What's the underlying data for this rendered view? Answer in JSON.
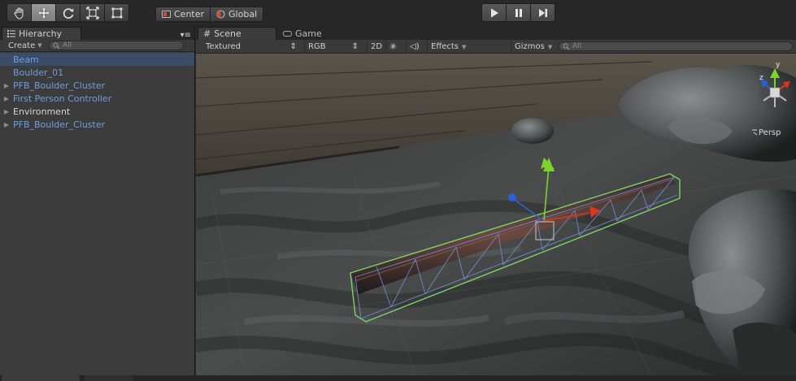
{
  "toolbar": {
    "transform_tools": [
      {
        "name": "hand-tool",
        "icon": "hand-icon"
      },
      {
        "name": "move-tool",
        "icon": "move-icon",
        "active": true
      },
      {
        "name": "rotate-tool",
        "icon": "rotate-icon"
      },
      {
        "name": "scale-tool",
        "icon": "scale-icon"
      },
      {
        "name": "rect-tool",
        "icon": "rect-icon"
      }
    ],
    "pivot_label": "Center",
    "space_label": "Global",
    "playback": [
      "play-icon",
      "pause-icon",
      "step-icon"
    ]
  },
  "hierarchy": {
    "tab_label": "Hierarchy",
    "create_label": "Create",
    "search_placeholder": "All",
    "items": [
      {
        "label": "Beam",
        "expandable": false,
        "selected": true,
        "color": "#6d9de0"
      },
      {
        "label": "Boulder_01",
        "expandable": false,
        "color": "#6d9de0"
      },
      {
        "label": "PFB_Boulder_Cluster",
        "expandable": true,
        "color": "#6d9de0"
      },
      {
        "label": "First Person Controller",
        "expandable": true,
        "color": "#6d9de0"
      },
      {
        "label": "Environment",
        "expandable": true,
        "color": "#d6d6d6"
      },
      {
        "label": "PFB_Boulder_Cluster",
        "expandable": true,
        "color": "#6d9de0"
      }
    ]
  },
  "scene": {
    "tab_scene": "Scene",
    "tab_game": "Game",
    "render_mode": "Textured",
    "color_mode": "RGB",
    "mode_2d": "2D",
    "effects_label": "Effects",
    "gizmos_label": "Gizmos",
    "search_placeholder": "All",
    "gizmo_axis_y": "y",
    "gizmo_axis_z": "z",
    "persp_label": "Persp"
  },
  "colors": {
    "axis_x": "#d8381e",
    "axis_y": "#7cd32e",
    "axis_z": "#2d5fd6",
    "selection_outline": "#7fd26a",
    "wireframe": "#6f86c9"
  }
}
